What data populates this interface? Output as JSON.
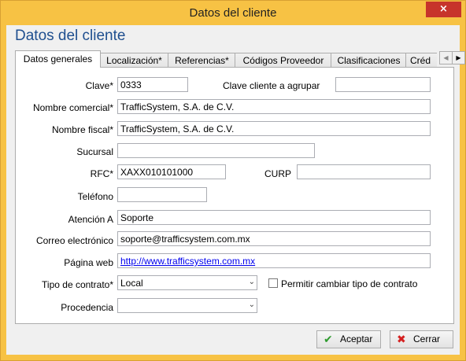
{
  "window": {
    "title": "Datos del cliente",
    "close_icon": "×"
  },
  "heading": "Datos del cliente",
  "tabs": [
    {
      "label": "Datos generales",
      "active": true
    },
    {
      "label": "Localización*",
      "active": false
    },
    {
      "label": "Referencias*",
      "active": false
    },
    {
      "label": "Códigos Proveedor",
      "active": false
    },
    {
      "label": "Clasificaciones",
      "active": false
    },
    {
      "label": "Créd",
      "active": false
    }
  ],
  "tab_scroll": {
    "left": "◀",
    "right": "▶"
  },
  "form": {
    "clave": {
      "label": "Clave*",
      "value": "0333"
    },
    "clave_agrupar": {
      "label": "Clave cliente a agrupar",
      "value": ""
    },
    "nombre_comercial": {
      "label": "Nombre comercial*",
      "value": "TrafficSystem, S.A. de C.V."
    },
    "nombre_fiscal": {
      "label": "Nombre fiscal*",
      "value": "TrafficSystem, S.A. de C.V."
    },
    "sucursal": {
      "label": "Sucursal",
      "value": ""
    },
    "rfc": {
      "label": "RFC*",
      "value": "XAXX010101000"
    },
    "curp": {
      "label": "CURP",
      "value": ""
    },
    "telefono": {
      "label": "Teléfono",
      "value": ""
    },
    "atencion": {
      "label": "Atención A",
      "value": "Soporte"
    },
    "correo": {
      "label": "Correo electrónico",
      "value": "soporte@trafficsystem.com.mx"
    },
    "pagina": {
      "label": "Página web",
      "value": "http://www.trafficsystem.com.mx"
    },
    "tipo_contrato": {
      "label": "Tipo de contrato*",
      "value": "Local"
    },
    "permitir": {
      "label": "Permitir cambiar tipo de contrato",
      "checked": false
    },
    "procedencia": {
      "label": "Procedencia",
      "value": ""
    }
  },
  "buttons": {
    "aceptar": {
      "label": "Aceptar",
      "icon": "✔",
      "icon_color": "#2e9b2e"
    },
    "cerrar": {
      "label": "Cerrar",
      "icon": "✖",
      "icon_color": "#d42020"
    }
  }
}
